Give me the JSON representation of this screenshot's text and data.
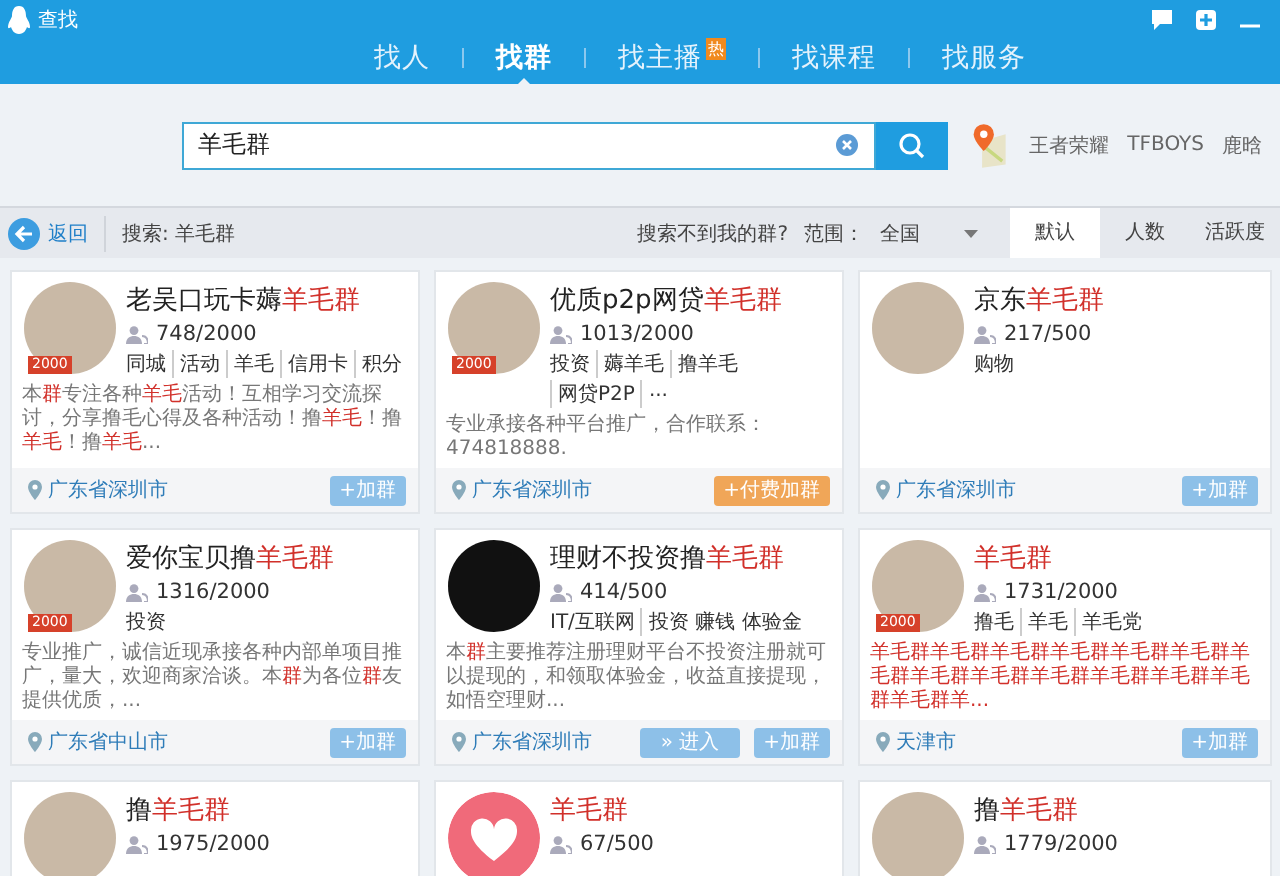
{
  "window": {
    "title": "查找"
  },
  "tabs": [
    {
      "label": "找人",
      "selected": false
    },
    {
      "label": "找群",
      "selected": true
    },
    {
      "label": "找主播",
      "selected": false,
      "badge": "热"
    },
    {
      "label": "找课程",
      "selected": false
    },
    {
      "label": "找服务",
      "selected": false
    }
  ],
  "search": {
    "value": "羊毛群",
    "hot_words": [
      "王者荣耀",
      "TFBOYS",
      "鹿晗"
    ]
  },
  "toolbar": {
    "back": "返回",
    "query": "搜索: 羊毛群",
    "help_link": "搜索不到我的群?",
    "scope_label": "范围：",
    "scope_value": "全国",
    "sort_tabs": [
      {
        "label": "默认",
        "selected": true
      },
      {
        "label": "人数",
        "selected": false
      },
      {
        "label": "活跃度",
        "selected": false
      }
    ]
  },
  "groups": [
    {
      "kind": "photo",
      "name_prefix": "老吴口玩卡薅",
      "name_highlight": "羊毛群",
      "badge": "2000",
      "members": "748/2000",
      "tags": [
        "同城",
        "活动",
        "羊毛",
        "信用卡",
        "积分"
      ],
      "description": [
        {
          "text": "本",
          "highlight": false
        },
        {
          "text": "群",
          "highlight": true
        },
        {
          "text": "专注各种",
          "highlight": false
        },
        {
          "text": "羊毛",
          "highlight": true
        },
        {
          "text": "活动！互相学习交流探讨，分享撸毛心得及各种活动！撸",
          "highlight": false
        },
        {
          "text": "羊毛",
          "highlight": true
        },
        {
          "text": "！撸",
          "highlight": false
        },
        {
          "text": "羊毛",
          "highlight": true
        },
        {
          "text": "！撸",
          "highlight": false
        },
        {
          "text": "羊毛",
          "highlight": true
        },
        {
          "text": "...",
          "highlight": false
        }
      ],
      "location": "广东省深圳市",
      "buttons": [
        {
          "label": "+加群",
          "kind": "join"
        }
      ]
    },
    {
      "kind": "photo",
      "name_prefix": "优质p2p网贷",
      "name_highlight": "羊毛群",
      "badge": "2000",
      "members": "1013/2000",
      "tags": [
        "投资",
        "薅羊毛",
        "撸羊毛",
        "网贷P2P",
        "..."
      ],
      "description": [
        {
          "text": "专业承接各种平台推广，合作联系：474818888.",
          "highlight": false
        }
      ],
      "location": "广东省深圳市",
      "buttons": [
        {
          "label": "+付费加群",
          "kind": "paid"
        }
      ]
    },
    {
      "kind": "photo",
      "name_prefix": "京东",
      "name_highlight": "羊毛群",
      "members": "217/500",
      "tags": [
        "购物"
      ],
      "location": "广东省深圳市",
      "buttons": [
        {
          "label": "+加群",
          "kind": "join"
        }
      ]
    },
    {
      "kind": "photo",
      "name_prefix": "爱你宝贝撸",
      "name_highlight": "羊毛群",
      "badge": "2000",
      "members": "1316/2000",
      "tags": [
        "投资"
      ],
      "description": [
        {
          "text": "专业推广，诚信近现承接各种内部单项目推广，量大，欢迎商家洽谈。本",
          "highlight": false
        },
        {
          "text": "群",
          "highlight": true
        },
        {
          "text": "为各位",
          "highlight": false
        },
        {
          "text": "群",
          "highlight": true
        },
        {
          "text": "友提供优质，...",
          "highlight": false
        }
      ],
      "location": "广东省中山市",
      "buttons": [
        {
          "label": "+加群",
          "kind": "join"
        }
      ]
    },
    {
      "kind": "dark",
      "name_prefix": "理财不投资撸",
      "name_highlight": "羊毛群",
      "members": "414/500",
      "tags": [
        "IT/互联网",
        "投资 赚钱 体验金"
      ],
      "description": [
        {
          "text": "本",
          "highlight": false
        },
        {
          "text": "群",
          "highlight": true
        },
        {
          "text": "主要推荐注册理财平台不投资注册就可以提现的，和领取体验金，收益直接提现，如悟空理财...",
          "highlight": false
        }
      ],
      "location": "广东省深圳市",
      "buttons": [
        {
          "label": "» 进入",
          "kind": "enter"
        },
        {
          "label": "+加群",
          "kind": "join"
        }
      ]
    },
    {
      "kind": "photo",
      "name_highlight": "羊毛群",
      "badge": "2000",
      "members": "1731/2000",
      "tags": [
        "撸毛",
        "羊毛",
        "羊毛党"
      ],
      "description": [
        {
          "text": "羊毛群羊毛群羊毛群羊毛群羊毛群羊毛群羊毛群羊毛群羊毛群羊毛群羊毛群羊毛群羊毛群羊毛群羊...",
          "highlight": true
        }
      ],
      "location": "天津市",
      "buttons": [
        {
          "label": "+加群",
          "kind": "join"
        }
      ]
    },
    {
      "kind": "photo",
      "name_prefix": "撸",
      "name_highlight": "羊毛群",
      "members": "1975/2000"
    },
    {
      "kind": "heart",
      "name_highlight": "羊毛群",
      "members": "67/500"
    },
    {
      "kind": "photo",
      "name_prefix": "撸",
      "name_highlight": "羊毛群",
      "members": "1779/2000"
    }
  ]
}
